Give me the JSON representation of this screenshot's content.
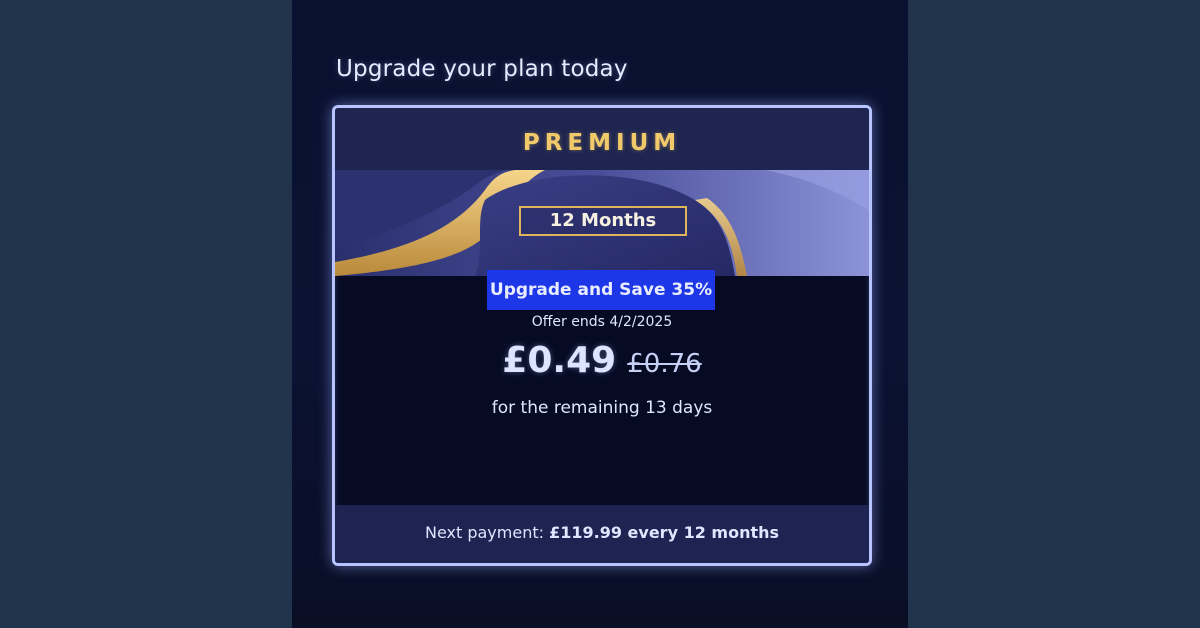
{
  "screen": {
    "title": "Upgrade your plan today"
  },
  "plan_card": {
    "tier": "PREMIUM",
    "duration": "12 Months",
    "offer_badge": "Upgrade and Save 35%",
    "offer_ends": "Offer ends 4/2/2025",
    "price_new": "£0.49",
    "price_old": "£0.76",
    "remaining": "for the remaining 13 days",
    "next_payment_label": "Next payment:",
    "next_payment_amount": "£119.99 every 12 months"
  },
  "colors": {
    "tier_gold": "#f0c96a",
    "badge_blue": "#1d36e8",
    "card_border": "#b8c4ff"
  }
}
